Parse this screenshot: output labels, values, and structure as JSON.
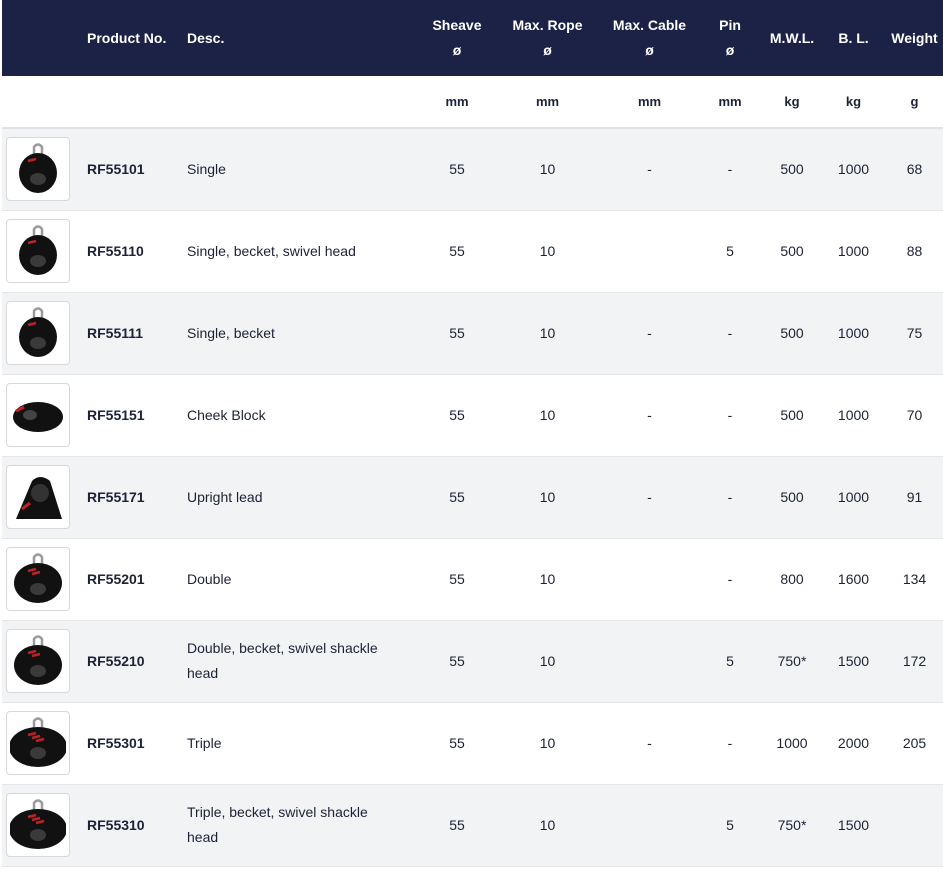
{
  "header": {
    "product_no": "Product No.",
    "desc": "Desc.",
    "sheave_l1": "Sheave",
    "sheave_l2": "ø",
    "rope_l1": "Max. Rope",
    "rope_l2": "ø",
    "cable_l1": "Max. Cable",
    "cable_l2": "ø",
    "pin_l1": "Pin",
    "pin_l2": "ø",
    "mwl": "M.W.L.",
    "bl": "B. L.",
    "weight": "Weight"
  },
  "units": {
    "sheave": "mm",
    "rope": "mm",
    "cable": "mm",
    "pin": "mm",
    "mwl": "kg",
    "bl": "kg",
    "weight": "g"
  },
  "rows": [
    {
      "icon": "single-block-icon",
      "product": "RF55101",
      "desc": "Single",
      "sheave": "55",
      "rope": "10",
      "cable": "-",
      "pin": "-",
      "mwl": "500",
      "bl": "1000",
      "weight": "68"
    },
    {
      "icon": "swivel-block-icon",
      "product": "RF55110",
      "desc": "Single, becket, swivel head",
      "sheave": "55",
      "rope": "10",
      "cable": "",
      "pin": "5",
      "mwl": "500",
      "bl": "1000",
      "weight": "88"
    },
    {
      "icon": "single-becket-block-icon",
      "product": "RF55111",
      "desc": "Single, becket",
      "sheave": "55",
      "rope": "10",
      "cable": "-",
      "pin": "-",
      "mwl": "500",
      "bl": "1000",
      "weight": "75"
    },
    {
      "icon": "cheek-block-icon",
      "product": "RF55151",
      "desc": "Cheek Block",
      "sheave": "55",
      "rope": "10",
      "cable": "-",
      "pin": "-",
      "mwl": "500",
      "bl": "1000",
      "weight": "70"
    },
    {
      "icon": "upright-lead-block-icon",
      "product": "RF55171",
      "desc": "Upright lead",
      "sheave": "55",
      "rope": "10",
      "cable": "-",
      "pin": "-",
      "mwl": "500",
      "bl": "1000",
      "weight": "91"
    },
    {
      "icon": "double-block-icon",
      "product": "RF55201",
      "desc": "Double",
      "sheave": "55",
      "rope": "10",
      "cable": "",
      "pin": "-",
      "mwl": "800",
      "bl": "1600",
      "weight": "134"
    },
    {
      "icon": "double-swivel-block-icon",
      "product": "RF55210",
      "desc": "Double, becket, swivel shackle head",
      "sheave": "55",
      "rope": "10",
      "cable": "",
      "pin": "5",
      "mwl": "750*",
      "bl": "1500",
      "weight": "172"
    },
    {
      "icon": "triple-block-icon",
      "product": "RF55301",
      "desc": "Triple",
      "sheave": "55",
      "rope": "10",
      "cable": "-",
      "pin": "-",
      "mwl": "1000",
      "bl": "2000",
      "weight": "205"
    },
    {
      "icon": "triple-swivel-block-icon",
      "product": "RF55310",
      "desc": "Triple, becket, swivel shackle head",
      "sheave": "55",
      "rope": "10",
      "cable": "",
      "pin": "5",
      "mwl": "750*",
      "bl": "1500",
      "weight": ""
    }
  ],
  "colors": {
    "header_bg": "#1b2246",
    "header_text": "#ffffff",
    "row_alt": "#f2f3f5",
    "text": "#1b2235",
    "block_body": "#111111",
    "block_accent": "#c0202a"
  }
}
